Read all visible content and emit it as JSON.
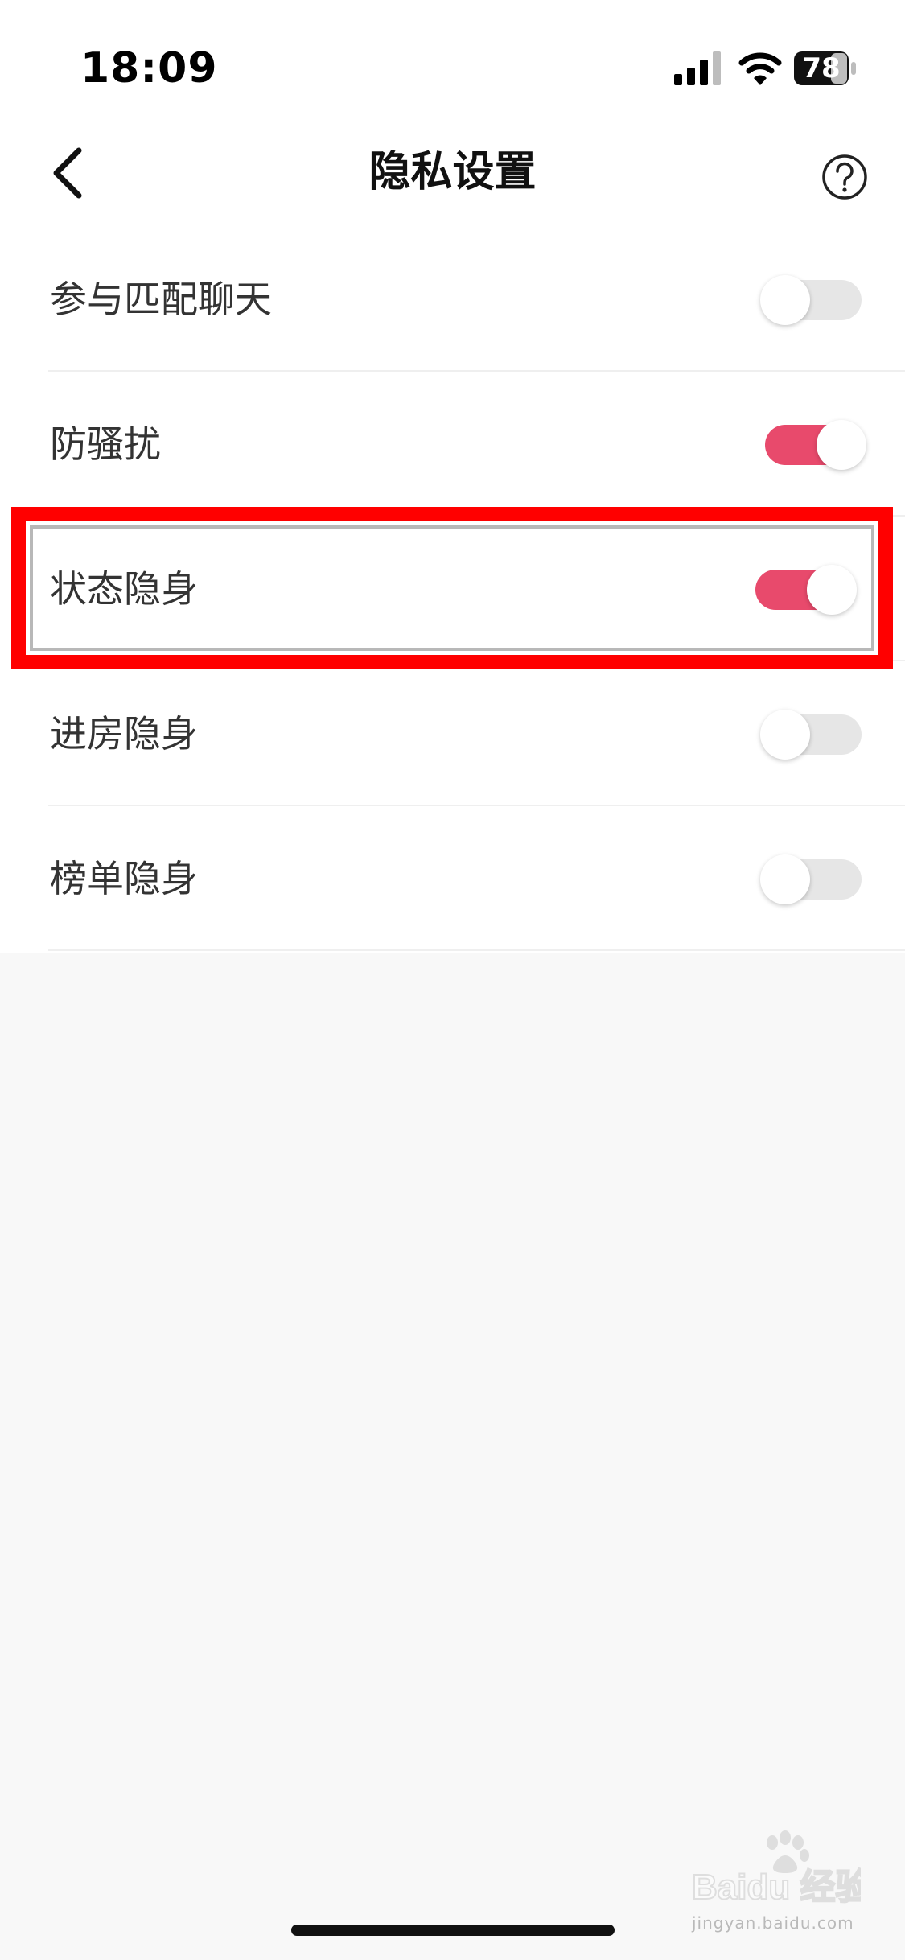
{
  "status_bar": {
    "time": "18:09",
    "battery_level": "78"
  },
  "nav": {
    "title": "隐私设置"
  },
  "settings": [
    {
      "label": "参与匹配聊天",
      "enabled": false
    },
    {
      "label": "防骚扰",
      "enabled": true
    },
    {
      "label": "状态隐身",
      "enabled": true
    },
    {
      "label": "进房隐身",
      "enabled": false
    },
    {
      "label": "榜单隐身",
      "enabled": false
    }
  ],
  "colors": {
    "toggle_on": "#e84a6c",
    "toggle_off": "#e6e6e6",
    "highlight": "#ff0000"
  },
  "watermark": {
    "text": "Baidu 经验",
    "sub": "jingyan.baidu.com"
  }
}
